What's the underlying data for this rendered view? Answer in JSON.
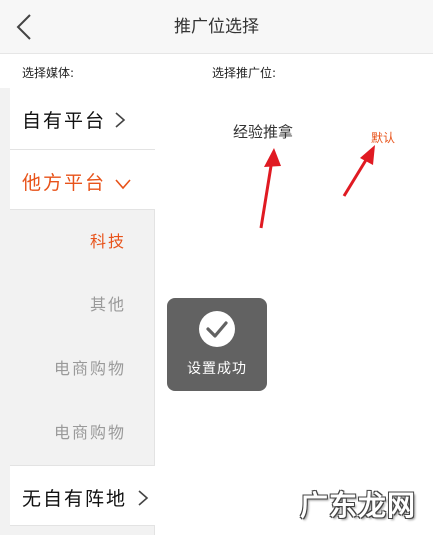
{
  "header": {
    "title": "推广位选择",
    "back_icon": "chevron-left-icon"
  },
  "labels": {
    "media": "选择媒体:",
    "position": "选择推广位:"
  },
  "sidebar": {
    "items": [
      {
        "label": "自有平台",
        "state": "collapsed"
      },
      {
        "label": "他方平台",
        "state": "expanded"
      },
      {
        "label": "无自有阵地",
        "state": "collapsed"
      }
    ],
    "sub_items": [
      {
        "label": "科技",
        "active": true
      },
      {
        "label": "其他",
        "active": false
      },
      {
        "label": "电商购物",
        "active": false
      },
      {
        "label": "电商购物",
        "active": false
      }
    ]
  },
  "positions": [
    {
      "label": "经验推拿"
    }
  ],
  "default_tag": "默认",
  "toast": {
    "text": "设置成功",
    "icon": "check-circle-icon"
  },
  "watermark": "广东龙网",
  "colors": {
    "accent": "#e8531a",
    "annotation_arrow": "#e01a22",
    "toast_bg": "#5a5a5a"
  }
}
